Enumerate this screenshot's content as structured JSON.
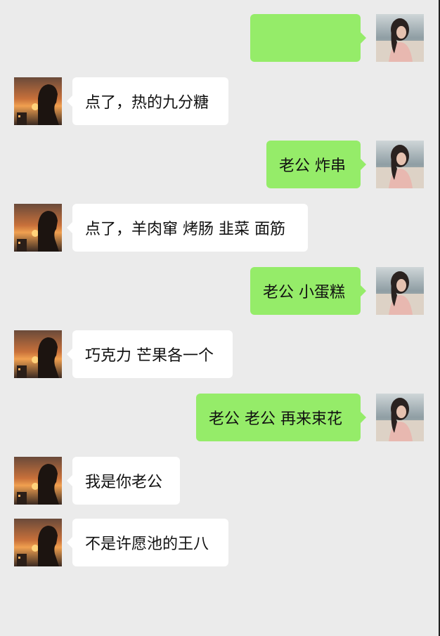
{
  "chat": {
    "messages": [
      {
        "side": "right",
        "text": ""
      },
      {
        "side": "left",
        "text": "点了，热的九分糖"
      },
      {
        "side": "right",
        "text": "老公 炸串"
      },
      {
        "side": "left",
        "text": "点了，羊肉窜 烤肠 韭菜 面筋"
      },
      {
        "side": "right",
        "text": "老公 小蛋糕"
      },
      {
        "side": "left",
        "text": "巧克力 芒果各一个"
      },
      {
        "side": "right",
        "text": "老公 老公 再来束花"
      },
      {
        "side": "left",
        "text": "我是你老公"
      },
      {
        "side": "left",
        "text": "不是许愿池的王八"
      }
    ]
  },
  "colors": {
    "background": "#ebebeb",
    "sent_bubble": "#95ec69",
    "received_bubble": "#ffffff"
  },
  "icons": {
    "sender_avatar": "girl-portrait-avatar",
    "receiver_avatar": "sunset-silhouette-avatar"
  }
}
